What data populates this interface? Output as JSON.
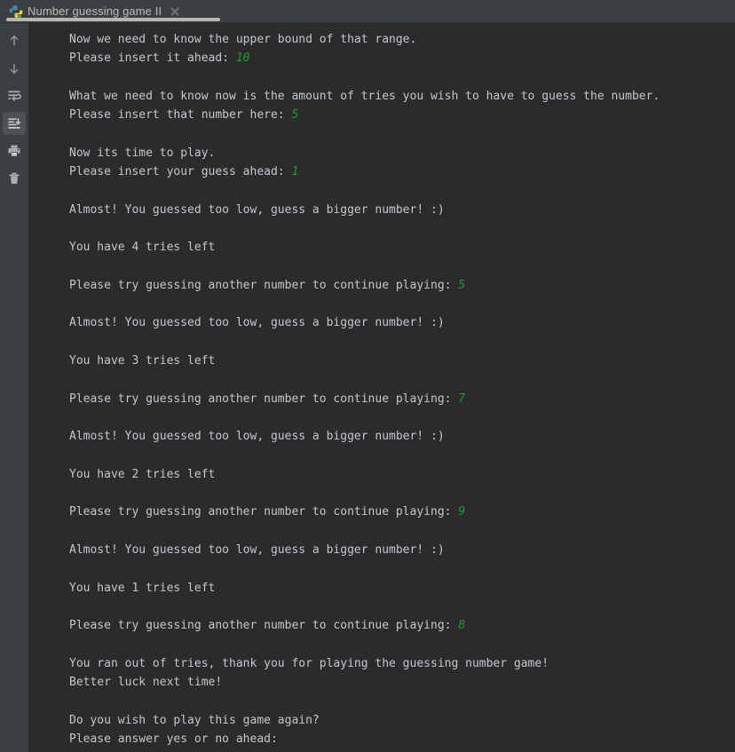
{
  "window": {
    "tab": {
      "title": "Number guessing game II",
      "icon": "python-file-icon",
      "running_badge": true,
      "close_icon": "close-icon",
      "active": true
    }
  },
  "toolbar": {
    "buttons": [
      {
        "name": "up-arrow-icon",
        "tooltip": "Previous Occurrence",
        "active": false
      },
      {
        "name": "down-arrow-icon",
        "tooltip": "Next Occurrence",
        "active": false
      },
      {
        "name": "soft-wrap-icon",
        "tooltip": "Soft-Wrap",
        "active": false
      },
      {
        "name": "scroll-to-end-icon",
        "tooltip": "Scroll to End",
        "active": true
      },
      {
        "name": "print-icon",
        "tooltip": "Print",
        "active": false
      },
      {
        "name": "trash-icon",
        "tooltip": "Clear All",
        "active": false
      }
    ]
  },
  "console": {
    "colors": {
      "background": "#2b2b2b",
      "text": "#c2c7d0",
      "user_input": "#1f9a35",
      "chrome": "#3c3f41",
      "tab_underline": "#b6b6b6"
    },
    "lines": [
      {
        "text": "Now we need to know the upper bound of that range."
      },
      {
        "text": "Please insert it ahead: ",
        "value": "10"
      },
      {
        "text": ""
      },
      {
        "text": "What we need to know now is the amount of tries you wish to have to guess the number."
      },
      {
        "text": "Please insert that number here: ",
        "value": "5"
      },
      {
        "text": ""
      },
      {
        "text": "Now its time to play."
      },
      {
        "text": "Please insert your guess ahead: ",
        "value": "1"
      },
      {
        "text": ""
      },
      {
        "text": "Almost! You guessed too low, guess a bigger number! :)"
      },
      {
        "text": ""
      },
      {
        "text": "You have 4 tries left"
      },
      {
        "text": ""
      },
      {
        "text": "Please try guessing another number to continue playing: ",
        "value": "5"
      },
      {
        "text": ""
      },
      {
        "text": "Almost! You guessed too low, guess a bigger number! :)"
      },
      {
        "text": ""
      },
      {
        "text": "You have 3 tries left"
      },
      {
        "text": ""
      },
      {
        "text": "Please try guessing another number to continue playing: ",
        "value": "7"
      },
      {
        "text": ""
      },
      {
        "text": "Almost! You guessed too low, guess a bigger number! :)"
      },
      {
        "text": ""
      },
      {
        "text": "You have 2 tries left"
      },
      {
        "text": ""
      },
      {
        "text": "Please try guessing another number to continue playing: ",
        "value": "9"
      },
      {
        "text": ""
      },
      {
        "text": "Almost! You guessed too low, guess a bigger number! :)"
      },
      {
        "text": ""
      },
      {
        "text": "You have 1 tries left"
      },
      {
        "text": ""
      },
      {
        "text": "Please try guessing another number to continue playing: ",
        "value": "8"
      },
      {
        "text": ""
      },
      {
        "text": "You ran out of tries, thank you for playing the guessing number game!"
      },
      {
        "text": "Better luck next time!"
      },
      {
        "text": ""
      },
      {
        "text": "Do you wish to play this game again?"
      },
      {
        "text": "Please answer yes or no ahead:"
      }
    ]
  }
}
